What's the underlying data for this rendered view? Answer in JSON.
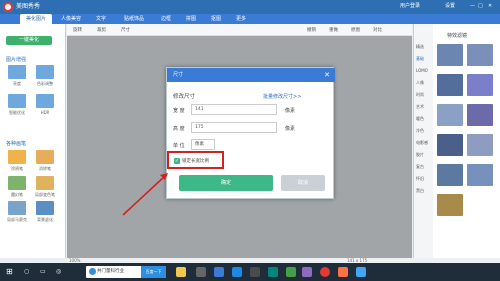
{
  "app": {
    "name": "美图秀秀",
    "account": "用户登录",
    "settings": "设置"
  },
  "menu_tabs": [
    "美化图片",
    "人像美容",
    "文字",
    "贴纸饰品",
    "边框",
    "拼图",
    "抠图",
    "更多"
  ],
  "left_panel": {
    "top_button": "一键美化",
    "section1_title": "图片增强",
    "section1_items": [
      "亮度",
      "色彩调整",
      "智能优化",
      "HDR"
    ],
    "section2_title": "各种画笔",
    "section2_items": [
      "涂鸦笔",
      "消除笔",
      "魔幻笔",
      "局部变色笔",
      "局部马赛克",
      "背景虚化"
    ]
  },
  "toolbar": {
    "items": [
      "旋转",
      "裁剪",
      "尺寸"
    ],
    "right_items": [
      "撤销",
      "重做",
      "原图",
      "对比"
    ]
  },
  "right_nav": [
    "精选",
    "基础",
    "LOMO",
    "人像",
    "时尚",
    "艺术",
    "暖色",
    "冷色",
    "电影感",
    "胶片",
    "复古",
    "怀旧",
    "黑白"
  ],
  "right_panel": {
    "title": "特效滤镜"
  },
  "dialog": {
    "title": "尺寸",
    "section": "修改尺寸",
    "batch_link": "批量修改尺寸>>",
    "width_label": "宽 度",
    "width_value": "141",
    "width_unit": "像素",
    "height_label": "高 度",
    "height_value": "175",
    "height_unit": "像素",
    "unit_label": "单 位",
    "unit_value": "像素",
    "lock_label": "锁定长宽比例",
    "lock_checked": true,
    "ok": "确定",
    "cancel": "取消"
  },
  "status": {
    "zoom": "100%",
    "size": "141 x 175"
  },
  "taskbar": {
    "search_text": "共门量科行业",
    "search_btn": "百度一下"
  },
  "colors": {
    "accent": "#3a7bd5",
    "ok": "#3db888",
    "highlight": "#d32020"
  }
}
